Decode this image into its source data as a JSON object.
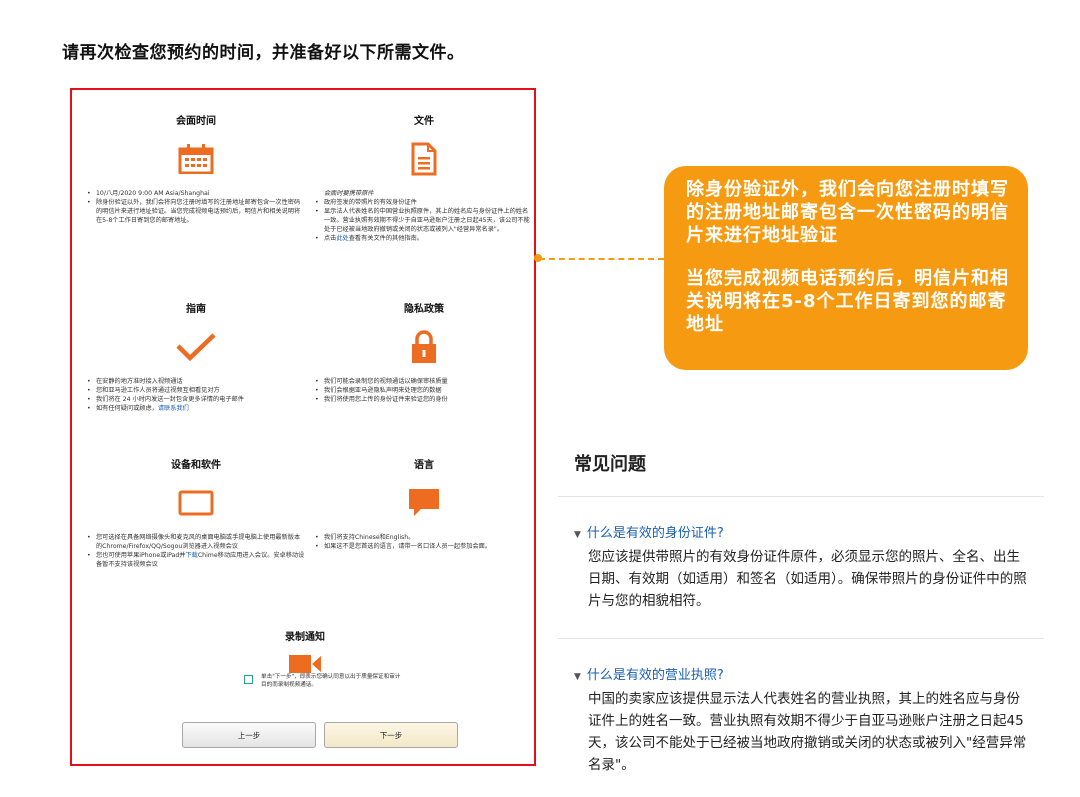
{
  "heading": "请再次检查您预约的时间，并准备好以下所需文件。",
  "frame": {
    "meeting": {
      "title": "会面时间",
      "items": [
        "10/八月/2020 9:00 AM Asia/Shanghai",
        "除身份验证以外，我们会将向您注册时填写的注册地址邮寄包含一次性密码的明信片来进行地址验证。当您完成视频电话预约后，明信片和相关说明将在5-8个工作日寄到您的邮寄地址。"
      ]
    },
    "docs": {
      "title": "文件",
      "intro": "会面时要携带原件",
      "items": [
        "政府签发的带照片的有效身份证件",
        "显示法人代表姓名的中国营业执照原件，其上的姓名应与身份证件上的姓名一致。营业执照有效期不得少于自亚马逊账户注册之日起45天，该公司不能处于已经被当地政府撤销或关闭的状态或被列入\"经营异常名录\"。"
      ],
      "link_prefix": "点击",
      "link_text": "此处",
      "link_suffix": "查看有关文件的其他指南。"
    },
    "guide": {
      "title": "指南",
      "items": [
        "在安静的地方准时接入视频通话",
        "您和亚马逊工作人员将通过视频互相看见对方",
        "我们将在 24 小时内发送一封包含更多详情的电子邮件"
      ],
      "contact_prefix": "如有任何疑问或顾虑，",
      "contact_link": "请联系我们"
    },
    "privacy": {
      "title": "隐私政策",
      "items": [
        "我们可能会录制您的视频通话以确保审核质量",
        "我们会根据亚马逊隐私声明来处理您的数据",
        "我们将使用您上传的身份证件来验证您的身份"
      ]
    },
    "device": {
      "title": "设备和软件",
      "items": [
        "您可选择在具备网络摄像头和麦克风的桌面电脑或手提电脑上使用最新版本的Chrome/Firefox/QQ/Sogou浏览器进入视频会议"
      ],
      "app_prefix": "您也可使用苹果iPhone或iPad并",
      "app_link": "下载",
      "app_suffix": "Chime移动应用进入会议。安卓移动设备暂不支持该视频会议"
    },
    "language": {
      "title": "语言",
      "items": [
        "我们将支持Chinese和English。",
        "如果这不是您首选的语言，请带一名口译人员一起参加会面。"
      ]
    },
    "recording": {
      "title": "录制通知",
      "consent": "单击\"下一步\"，即表示您确认同意以出于质量保证和审计目的而录制视频通话。"
    },
    "buttons": {
      "prev": "上一步",
      "next": "下一步"
    }
  },
  "callout": {
    "p1": "除身份验证外，我们会向您注册时填写的注册地址邮寄包含一次性密码的明信片来进行地址验证",
    "p2": "当您完成视频电话预约后，明信片和相关说明将在5-8个工作日寄到您的邮寄地址"
  },
  "faq": {
    "title": "常见问题",
    "items": [
      {
        "question": "什么是有效的身份证件?",
        "answer": "您应该提供带照片的有效身份证件原件，必须显示您的照片、全名、出生日期、有效期（如适用）和签名（如适用）。确保带照片的身份证件中的照片与您的相貌相符。"
      },
      {
        "question": "什么是有效的营业执照?",
        "answer": "中国的卖家应该提供显示法人代表姓名的营业执照，其上的姓名应与身份证件上的姓名一致。营业执照有效期不得少于自亚马逊账户注册之日起45天，该公司不能处于已经被当地政府撤销或关闭的状态或被列入\"经营异常名录\"。"
      }
    ]
  },
  "colors": {
    "accent_orange": "#f59a11",
    "icon_orange": "#ee6c22",
    "frame_red": "#e3101a",
    "link_blue": "#1a5fb4"
  },
  "icons": [
    "calendar-icon",
    "document-icon",
    "checkmark-icon",
    "lock-icon",
    "monitor-icon",
    "speech-bubble-icon",
    "video-camera-icon",
    "triangle-down-icon"
  ]
}
